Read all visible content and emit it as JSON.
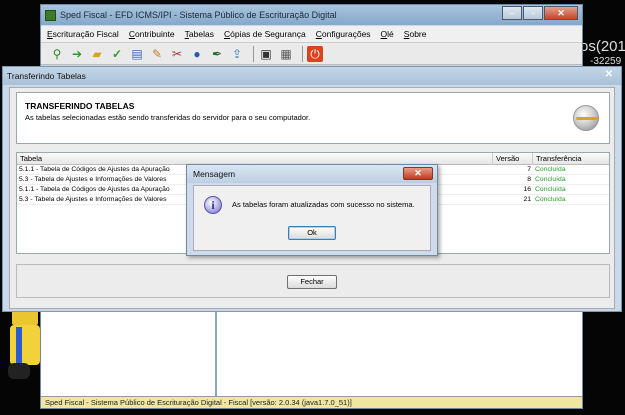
{
  "desktop": {
    "peek_text_1": "os(201",
    "peek_text_2": "-32259"
  },
  "main_window": {
    "title": "Sped Fiscal - EFD ICMS/IPI - Sistema Público de Escrituração Digital",
    "menu": [
      "Escrituração Fiscal",
      "Contribuinte",
      "Tabelas",
      "Cópias de Segurança",
      "Configurações",
      "Olé",
      "Sobre"
    ],
    "toolbar_icons": [
      "new-file-icon",
      "arrow-right-icon",
      "open-folder-icon",
      "checkmark-icon",
      "sheet-icon",
      "edit-document-icon",
      "tools-icon",
      "globe-icon",
      "signature-icon",
      "transmit-icon",
      "save-icon",
      "print-icon",
      "power-icon"
    ],
    "status_text": "Sped Fiscal - Sistema Público de Escrituração Digital - Fiscal [versão: 2.0.34 (java1.7.0_51)]"
  },
  "transfer_dialog": {
    "title": "Transferindo Tabelas",
    "header_title": "TRANSFERINDO TABELAS",
    "header_subtitle": "As tabelas selecionadas estão sendo transferidas do servidor para o seu computador.",
    "columns": {
      "table": "Tabela",
      "version": "Versão",
      "transfer": "Transferência"
    },
    "rows": [
      {
        "table": "5.1.1 - Tabela de Códigos de Ajustes da Apuração",
        "version": "7",
        "status": "Concluída"
      },
      {
        "table": "5.3 - Tabela de Ajustes e Informações de Valores",
        "version": "8",
        "status": "Concluída"
      },
      {
        "table": "5.1.1 - Tabela de Códigos de Ajustes da Apuração",
        "version": "16",
        "status": "Concluída"
      },
      {
        "table": "5.3 - Tabela de Ajustes e Informações de Valores",
        "version": "21",
        "status": "Concluída"
      }
    ],
    "close_button": "Fechar"
  },
  "message_box": {
    "title": "Mensagem",
    "text": "As tabelas foram atualizadas com sucesso no sistema.",
    "ok_button": "Ok",
    "icon": "info-icon"
  }
}
